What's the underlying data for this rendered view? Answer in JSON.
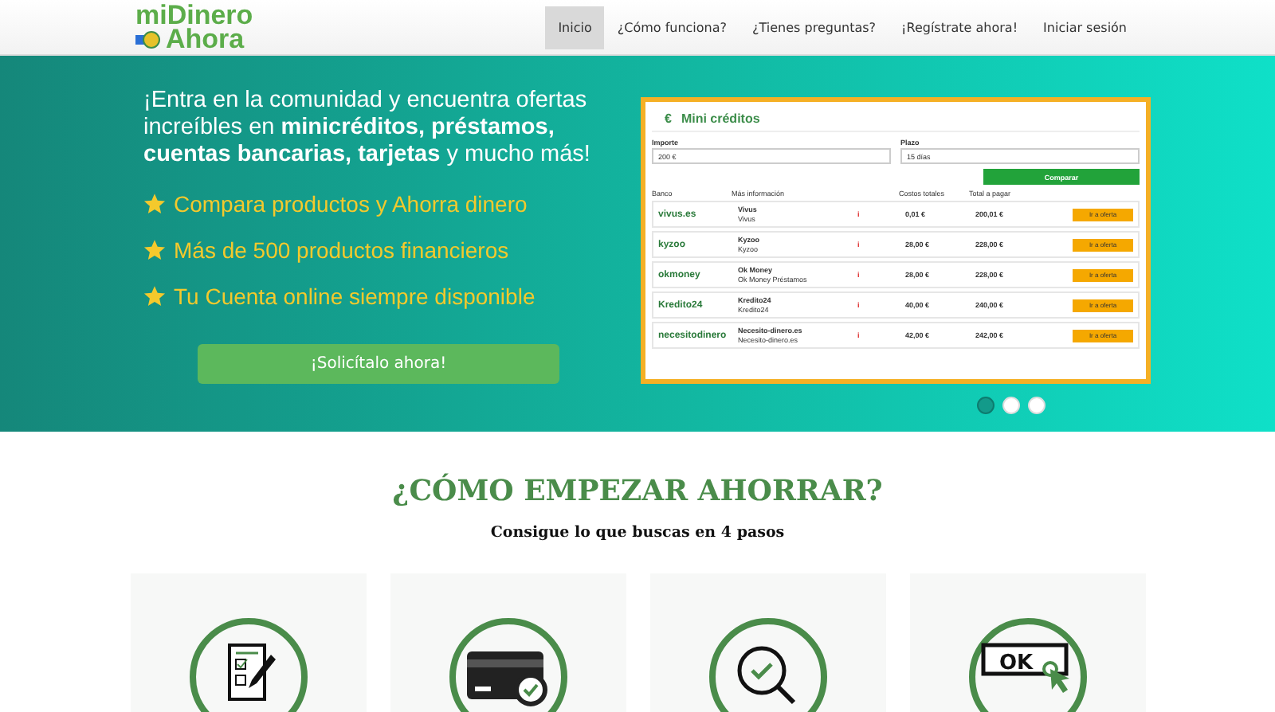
{
  "header": {
    "logo_top": "miDinero",
    "logo_bottom": "Ahora",
    "nav": [
      {
        "label": "Inicio",
        "selected": true
      },
      {
        "label": "¿Cómo funciona?",
        "selected": false
      },
      {
        "label": "¿Tienes preguntas?",
        "selected": false
      },
      {
        "label": "¡Regístrate ahora!",
        "selected": false
      },
      {
        "label": "Iniciar sesión",
        "selected": false
      }
    ]
  },
  "hero": {
    "heading": "¡Entra en la comunidad y encuentra ofertas increíbles en **minicréditos, préstamos, cuentas bancarias, tarjetas** y mucho más!",
    "features": [
      "Compara productos y Ahorra dinero",
      "Más de 500 productos financieros",
      "Tu Cuenta online siempre disponible"
    ],
    "cta": "¡Solicítalo ahora!",
    "slide": {
      "icon_text": "€",
      "title": "Mini créditos",
      "fields": [
        {
          "label": "Importe",
          "value": "200 €"
        },
        {
          "label": "Plazo",
          "value": "15 días"
        }
      ],
      "compare": "Comparar",
      "columns": [
        "Banco",
        "Más información",
        "Costos totales",
        "Total a pagar"
      ],
      "rows": [
        {
          "logo": "vivus.es",
          "name": "Vivus",
          "sub": "Vivus",
          "info": "i",
          "cost": "0,01 €",
          "total": "200,01 €",
          "action": "Ir a oferta"
        },
        {
          "logo": "kyzoo",
          "name": "Kyzoo",
          "sub": "Kyzoo",
          "info": "i",
          "cost": "28,00 €",
          "total": "228,00 €",
          "action": "Ir a oferta"
        },
        {
          "logo": "okmoney",
          "name": "Ok Money",
          "sub": "Ok Money Préstamos",
          "info": "i",
          "cost": "28,00 €",
          "total": "228,00 €",
          "action": "Ir a oferta"
        },
        {
          "logo": "Kredito24",
          "name": "Kredito24",
          "sub": "Kredito24",
          "info": "i",
          "cost": "40,00 €",
          "total": "240,00 €",
          "action": "Ir a oferta"
        },
        {
          "logo": "necesitodinero",
          "name": "Necesito-dinero.es",
          "sub": "Necesito-dinero.es",
          "info": "i",
          "cost": "42,00 €",
          "total": "242,00 €",
          "action": "Ir a oferta"
        }
      ]
    },
    "dots": [
      {
        "selected": true
      },
      {
        "selected": false
      },
      {
        "selected": false
      }
    ]
  },
  "steps_section": {
    "title": "¿CÓMO EMPEZAR AHORRAR?",
    "subtitle": "Consigue lo que buscas en 4 pasos",
    "steps": [
      {
        "kind": "form"
      },
      {
        "kind": "card"
      },
      {
        "kind": "search"
      },
      {
        "kind": "ok",
        "label": "OK"
      }
    ]
  }
}
